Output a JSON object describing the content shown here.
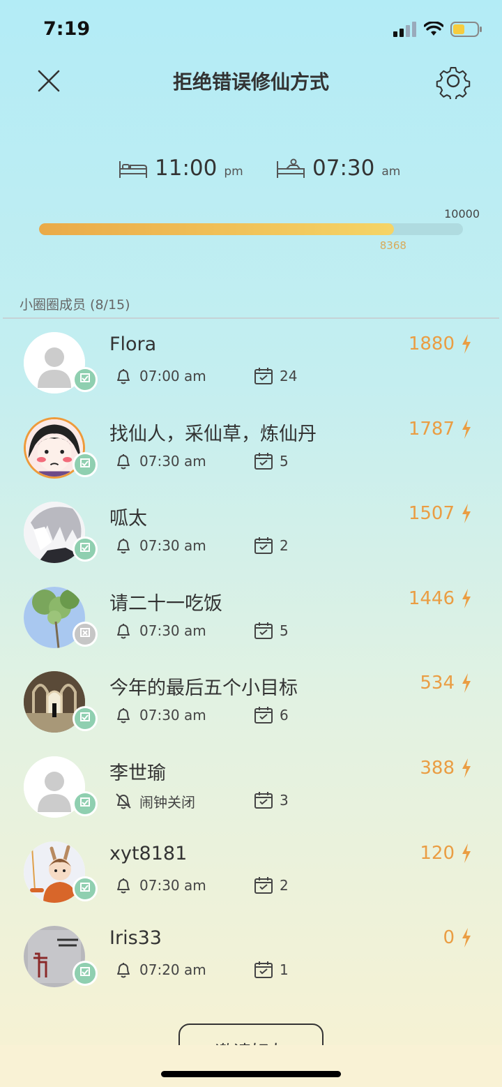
{
  "status_bar": {
    "time": "7:19"
  },
  "header": {
    "title": "拒绝错误修仙方式"
  },
  "schedule": {
    "bedtime": "11:00",
    "bedtime_suffix": "pm",
    "wake": "07:30",
    "wake_suffix": "am"
  },
  "progress": {
    "max": "10000",
    "current": "8368",
    "fraction": 0.8368
  },
  "section": {
    "title": "小圈圈成员 (8/15)"
  },
  "members": [
    {
      "name": "Flora",
      "points": "1880",
      "alarm": "07:00 am",
      "days": "24",
      "alarm_on": true,
      "checked": true
    },
    {
      "name": "找仙人，采仙草，炼仙丹",
      "points": "1787",
      "alarm": "07:30 am",
      "days": "5",
      "alarm_on": true,
      "checked": true
    },
    {
      "name": "呱太",
      "points": "1507",
      "alarm": "07:30 am",
      "days": "2",
      "alarm_on": true,
      "checked": true
    },
    {
      "name": "请二十一吃饭",
      "points": "1446",
      "alarm": "07:30 am",
      "days": "5",
      "alarm_on": true,
      "checked": false
    },
    {
      "name": "今年的最后五个小目标",
      "points": "534",
      "alarm": "07:30 am",
      "days": "6",
      "alarm_on": true,
      "checked": true
    },
    {
      "name": "李世瑜",
      "points": "388",
      "alarm": "闹钟关闭",
      "days": "3",
      "alarm_on": false,
      "checked": true
    },
    {
      "name": "xyt8181",
      "points": "120",
      "alarm": "07:30 am",
      "days": "2",
      "alarm_on": true,
      "checked": true
    },
    {
      "name": "Iris33",
      "points": "0",
      "alarm": "07:20 am",
      "days": "1",
      "alarm_on": true,
      "checked": true
    }
  ],
  "invite": {
    "label": "邀请好友"
  },
  "colors": {
    "accent": "#ea9d43",
    "badge": "#8fcfb0",
    "badge_off": "#c6c6c6"
  }
}
